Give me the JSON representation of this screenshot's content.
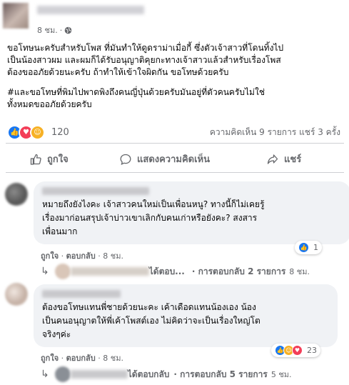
{
  "post": {
    "time": "8 ชม.",
    "paragraphs": [
      "ขอโทษนะครับสำหรับโพส ที่มันทำให้ดูดราม่าเมื่อกี้ ซึ่งตัวเจ้าสาวที่โดนทิ้งไป\nเป็นน้องสาวผม และผมก็ได้รับอนุญาติคุยกะทางเจ้าสาวแล้วสำหรับเรื่องโพส\nต้องขออภัยด้วยนะครับ ถ้าทำให้เข้าใจผิดกัน ขอโทษด้วยครับ",
      "#และขอโทษที่พิมไปพาดพิงถึงคนญี่ปุ่นด้วยครับมันอยู่ที่ตัวคนครับไม่ใช่\nทั้งหมดขออภัยด้วยครับ"
    ],
    "reaction_count": "120",
    "stats": "ความคิดเห็น 9 รายการ  แชร์ 3 ครั้ง"
  },
  "actions": {
    "like": "ถูกใจ",
    "comment": "แสดงความคิดเห็น",
    "share": "แชร์"
  },
  "comments": [
    {
      "text": "หมายถึงยังไงคะ เจ้าสาวคนใหม่เป็นเพื่อนหนู? ทางนี้ก็ไม่เคยรู้\nเรื่องมาก่อนสรุปเจ้าบ่าวเขาเลิกกับคนเก่าหรือยังคะ? สงสาร\nเพื่อนมาก",
      "like": "ถูกใจ",
      "reply": "ตอบกลับ",
      "time": "8 ชม.",
      "reactions": "1",
      "reply_info": {
        "label": "ได้ตอบ...",
        "count": "· การตอบกลับ 2 รายการ",
        "time": "8 ชม."
      }
    },
    {
      "text": "ต้องขอโทษแทนพี่ชายด้วยนะคะ เค้าเดือดแทนน้องเอง น้อง\nเป็นคนอนุญาตให้พี่เค้าโพสต์เอง ไม่คิดว่าจะเป็นเรื่องใหญ่โต\nจริงๆค่ะ",
      "like": "ถูกใจ",
      "reply": "ตอบกลับ",
      "time": "8 ชม.",
      "reactions": "23",
      "reply_info": {
        "label": "ได้ตอบกลับ",
        "count": "· การตอบกลับ 5 รายการ",
        "time": "5 ชม."
      }
    }
  ],
  "colors": {
    "like_blue": "#1877f2",
    "love_red": "#f33e58",
    "care_yellow": "#f7b125",
    "muted": "#65676b"
  }
}
